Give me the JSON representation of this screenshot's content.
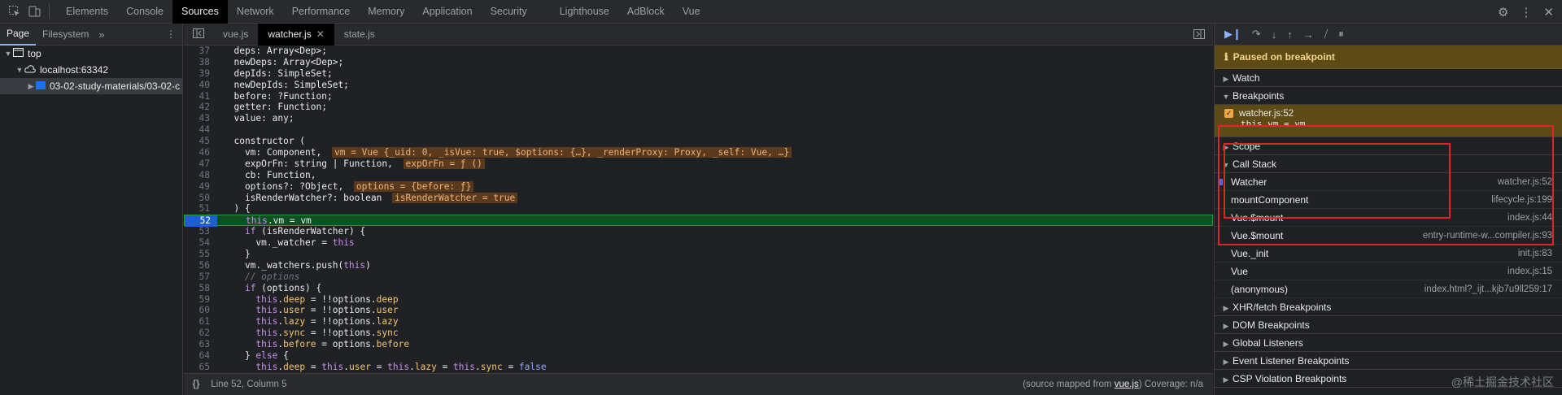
{
  "devtools": {
    "tabs": [
      "Elements",
      "Console",
      "Sources",
      "Network",
      "Performance",
      "Memory",
      "Application",
      "Security",
      "Lighthouse",
      "AdBlock",
      "Vue"
    ],
    "active_tab": "Sources"
  },
  "navigator": {
    "tabs": [
      "Page",
      "Filesystem"
    ],
    "more": "»",
    "tree": [
      {
        "label": "top",
        "indent": 0,
        "icon": "frame-icon",
        "caret": "▼"
      },
      {
        "label": "localhost:63342",
        "indent": 1,
        "icon": "cloud-icon",
        "caret": "▼"
      },
      {
        "label": "03-02-study-materials/03-02-c",
        "indent": 2,
        "icon": "folder-icon",
        "caret": "▶"
      }
    ]
  },
  "editor": {
    "tabs": [
      {
        "label": "vue.js",
        "active": false,
        "close": false
      },
      {
        "label": "watcher.js",
        "active": true,
        "close": true
      },
      {
        "label": "state.js",
        "active": false,
        "close": false
      }
    ],
    "status_left": "Line 52, Column 5",
    "status_right_prefix": "(source mapped from ",
    "status_right_link": "vue.js",
    "status_right_suffix": ") Coverage: n/a",
    "lines": [
      {
        "n": "37",
        "html": "  deps: Array&lt;Dep&gt;;"
      },
      {
        "n": "38",
        "html": "  newDeps: Array&lt;Dep&gt;;"
      },
      {
        "n": "39",
        "html": "  depIds: SimpleSet;"
      },
      {
        "n": "40",
        "html": "  newDepIds: SimpleSet;"
      },
      {
        "n": "41",
        "html": "  before: ?Function;"
      },
      {
        "n": "42",
        "html": "  getter: Function;"
      },
      {
        "n": "43",
        "html": "  value: any;"
      },
      {
        "n": "44",
        "html": ""
      },
      {
        "n": "45",
        "html": "  constructor ("
      },
      {
        "n": "46",
        "html": "    vm: Component, <span class=\"inl\">vm = Vue {_uid: 0, _isVue: true, $options: {…}, _renderProxy: Proxy, _self: Vue, …}</span>"
      },
      {
        "n": "47",
        "html": "    expOrFn: string | Function, <span class=\"inl\">expOrFn = ƒ ()</span>"
      },
      {
        "n": "48",
        "html": "    cb: Function,"
      },
      {
        "n": "49",
        "html": "    options?: ?Object, <span class=\"inl\">options = {before: ƒ}</span>"
      },
      {
        "n": "50",
        "html": "    isRenderWatcher?: boolean <span class=\"inl\">isRenderWatcher = true</span>"
      },
      {
        "n": "51",
        "html": "  ) {"
      },
      {
        "n": "52",
        "html": "    <span class=\"th\">this</span>.vm = vm",
        "cur": true
      },
      {
        "n": "53",
        "html": "    <span class=\"kw\">if</span> (isRenderWatcher) {"
      },
      {
        "n": "54",
        "html": "      vm._watcher = <span class=\"th\">this</span>"
      },
      {
        "n": "55",
        "html": "    }"
      },
      {
        "n": "56",
        "html": "    vm._watchers.push(<span class=\"th\">this</span>)"
      },
      {
        "n": "57",
        "html": "    <span class=\"cm\">// options</span>"
      },
      {
        "n": "58",
        "html": "    <span class=\"kw\">if</span> (options) {"
      },
      {
        "n": "59",
        "html": "      <span class=\"th\">this</span>.<span class=\"pr\">deep</span> = !!options.<span class=\"pr\">deep</span>"
      },
      {
        "n": "60",
        "html": "      <span class=\"th\">this</span>.<span class=\"pr\">user</span> = !!options.<span class=\"pr\">user</span>"
      },
      {
        "n": "61",
        "html": "      <span class=\"th\">this</span>.<span class=\"pr\">lazy</span> = !!options.<span class=\"pr\">lazy</span>"
      },
      {
        "n": "62",
        "html": "      <span class=\"th\">this</span>.<span class=\"pr\">sync</span> = !!options.<span class=\"pr\">sync</span>"
      },
      {
        "n": "63",
        "html": "      <span class=\"th\">this</span>.<span class=\"pr\">before</span> = options.<span class=\"pr\">before</span>"
      },
      {
        "n": "64",
        "html": "    } <span class=\"kw\">else</span> {"
      },
      {
        "n": "65",
        "html": "      <span class=\"th\">this</span>.<span class=\"pr\">deep</span> = <span class=\"th\">this</span>.<span class=\"pr\">user</span> = <span class=\"th\">this</span>.<span class=\"pr\">lazy</span> = <span class=\"th\">this</span>.<span class=\"pr\">sync</span> = <span class=\"kw2\">false</span>"
      }
    ]
  },
  "debugger": {
    "paused_label": "Paused on breakpoint",
    "watch_label": "Watch",
    "breakpoints_label": "Breakpoints",
    "breakpoint": {
      "file": "watcher.js:52",
      "code": "this.vm = vm"
    },
    "scope_label": "Scope",
    "callstack_label": "Call Stack",
    "frames": [
      {
        "name": "Watcher",
        "loc": "watcher.js:52",
        "current": true
      },
      {
        "name": "mountComponent",
        "loc": "lifecycle.js:199"
      },
      {
        "name": "Vue.$mount",
        "loc": "index.js:44"
      },
      {
        "name": "Vue.$mount",
        "loc": "entry-runtime-w...compiler.js:93"
      },
      {
        "name": "Vue._init",
        "loc": "init.js:83"
      },
      {
        "name": "Vue",
        "loc": "index.js:15"
      },
      {
        "name": "(anonymous)",
        "loc": "index.html?_ijt...kjb7u9ll259:17"
      }
    ],
    "collapsed_sections": [
      "XHR/fetch Breakpoints",
      "DOM Breakpoints",
      "Global Listeners",
      "Event Listener Breakpoints",
      "CSP Violation Breakpoints"
    ]
  },
  "watermark": "@稀土掘金技术社区",
  "colors": {
    "accent": "#8ab4f8",
    "highlight_box": "#e0242c",
    "paused_bg": "#5e4a14"
  }
}
